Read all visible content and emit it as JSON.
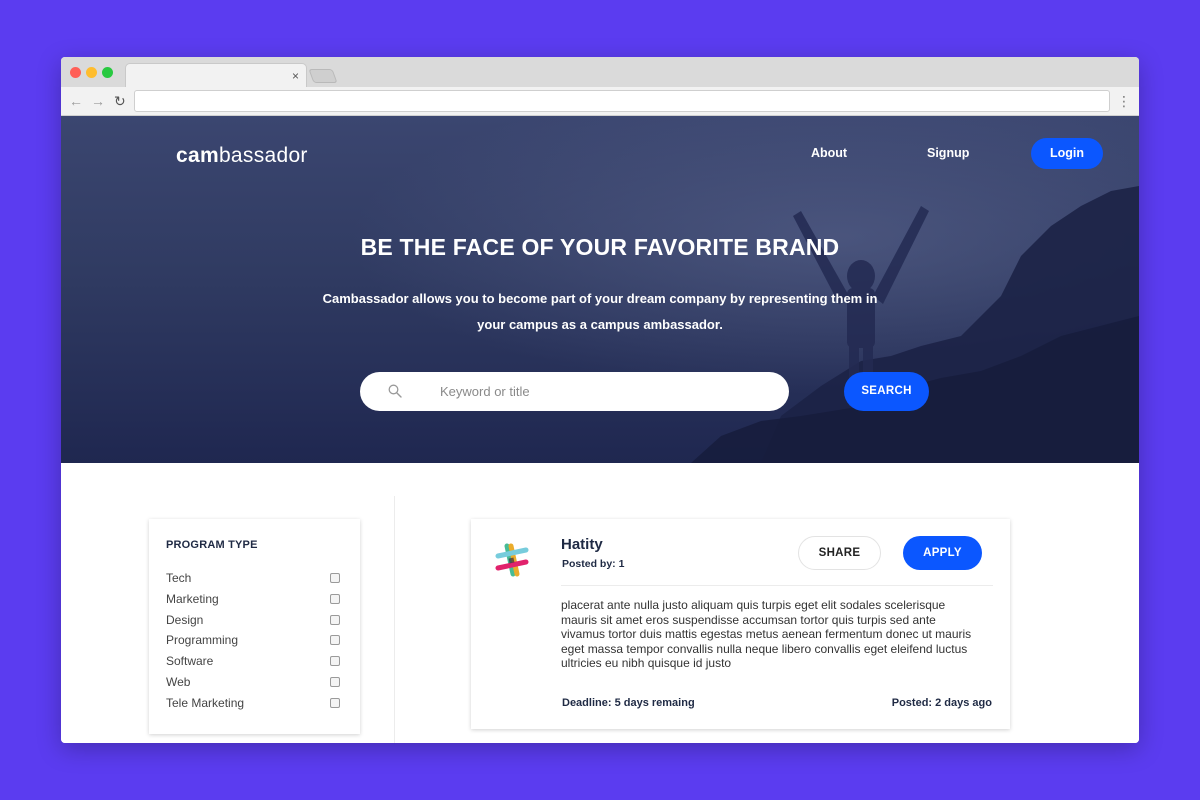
{
  "browser": {
    "tab_close": "×",
    "address": "",
    "nav": {
      "back": "←",
      "forward": "→",
      "reload": "↻",
      "menu": "⋮"
    }
  },
  "header": {
    "logo_bold": "cam",
    "logo_rest": "bassador",
    "nav_about": "About",
    "nav_signup": "Signup",
    "login_label": "Login"
  },
  "hero": {
    "title": "BE THE FACE OF YOUR FAVORITE BRAND",
    "subtitle": "Cambassador allows you to become part of your dream company by representing them in your campus as a campus ambassador.",
    "search_placeholder": "Keyword or title",
    "search_button": "SEARCH"
  },
  "filters": {
    "title": "PROGRAM TYPE",
    "items": [
      "Tech",
      "Marketing",
      "Design",
      "Programming",
      "Software",
      "Web",
      "Tele Marketing"
    ]
  },
  "job": {
    "title": "Hatity",
    "posted_by": "Posted by: 1",
    "share_label": "SHARE",
    "apply_label": "APPLY",
    "description": "placerat ante nulla justo aliquam quis turpis eget elit sodales scelerisque mauris sit amet eros suspendisse accumsan tortor quis turpis sed ante vivamus tortor duis mattis egestas metus aenean fermentum donec ut mauris eget massa tempor convallis nulla neque libero convallis eget eleifend luctus ultricies eu nibh quisque id justo",
    "deadline": "Deadline: 5 days remaing",
    "posted": "Posted: 2 days ago"
  },
  "colors": {
    "page_bg": "#5b3cf0",
    "accent": "#0b57ff",
    "hero_dark": "#1f2750",
    "text_dark": "#1f2a44"
  },
  "icons": [
    "search-icon",
    "slack-logo-icon",
    "back-arrow-icon",
    "forward-arrow-icon",
    "reload-icon",
    "menu-dots-icon",
    "tab-close-icon"
  ]
}
